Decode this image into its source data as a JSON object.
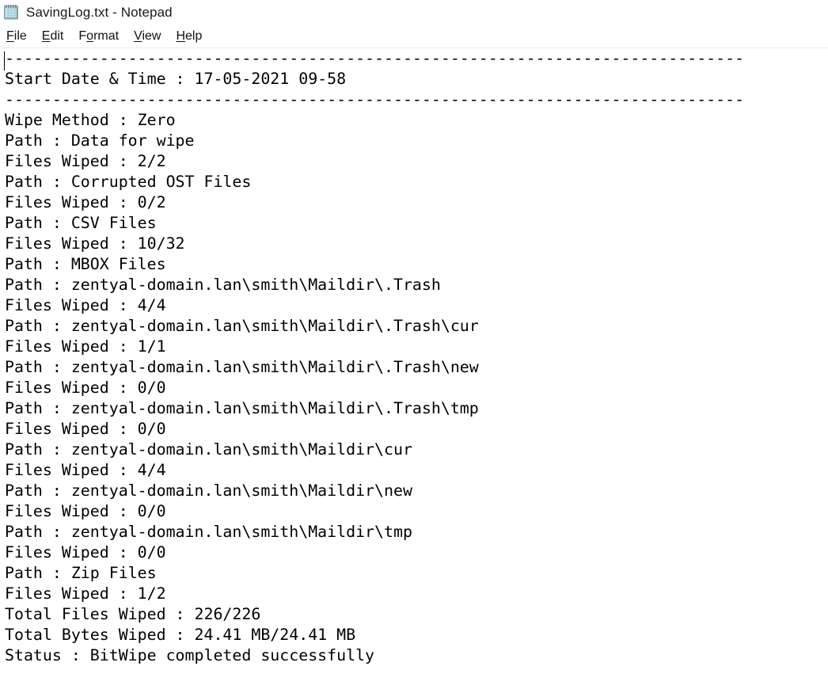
{
  "window": {
    "title": "SavingLog.txt - Notepad",
    "file_name": "SavingLog.txt",
    "app_name": "Notepad",
    "icon": "notepad-icon",
    "background_color": "#ffffff",
    "text_color": "#000000"
  },
  "menubar": {
    "items": [
      {
        "label": "File",
        "accel": "F",
        "before": "",
        "after": "ile"
      },
      {
        "label": "Edit",
        "accel": "E",
        "before": "",
        "after": "dit"
      },
      {
        "label": "Format",
        "accel": "o",
        "before": "F",
        "after": "rmat"
      },
      {
        "label": "View",
        "accel": "V",
        "before": "",
        "after": "iew"
      },
      {
        "label": "Help",
        "accel": "H",
        "before": "",
        "after": "elp"
      }
    ]
  },
  "document": {
    "caret_visible": true,
    "separator": "------------------------------------------------------------------------------",
    "header": {
      "start_label": "Start Date & Time",
      "start_value": "17-05-2021 09-58"
    },
    "summary": {
      "wipe_method_label": "Wipe Method",
      "wipe_method_value": "Zero",
      "total_files_label": "Total Files Wiped",
      "total_files_value": "226/226",
      "total_bytes_label": "Total Bytes Wiped",
      "total_bytes_value": "24.41 MB/24.41 MB",
      "status_label": "Status",
      "status_value": "BitWipe completed successfully"
    },
    "entries": [
      {
        "path": "Data for wipe",
        "files_wiped": "2/2"
      },
      {
        "path": "Corrupted OST Files",
        "files_wiped": "0/2"
      },
      {
        "path": "CSV Files",
        "files_wiped": "10/32"
      },
      {
        "path": "MBOX Files",
        "files_wiped": null
      },
      {
        "path": "zentyal-domain.lan\\smith\\Maildir\\.Trash",
        "files_wiped": "4/4"
      },
      {
        "path": "zentyal-domain.lan\\smith\\Maildir\\.Trash\\cur",
        "files_wiped": "1/1"
      },
      {
        "path": "zentyal-domain.lan\\smith\\Maildir\\.Trash\\new",
        "files_wiped": "0/0"
      },
      {
        "path": "zentyal-domain.lan\\smith\\Maildir\\.Trash\\tmp",
        "files_wiped": "0/0"
      },
      {
        "path": "zentyal-domain.lan\\smith\\Maildir\\cur",
        "files_wiped": "4/4"
      },
      {
        "path": "zentyal-domain.lan\\smith\\Maildir\\new",
        "files_wiped": "0/0"
      },
      {
        "path": "zentyal-domain.lan\\smith\\Maildir\\tmp",
        "files_wiped": "0/0"
      },
      {
        "path": "Zip Files",
        "files_wiped": "1/2"
      }
    ],
    "body_text": "------------------------------------------------------------------------------\nStart Date & Time : 17-05-2021 09-58\n------------------------------------------------------------------------------\nWipe Method : Zero\nPath : Data for wipe\nFiles Wiped : 2/2\nPath : Corrupted OST Files\nFiles Wiped : 0/2\nPath : CSV Files\nFiles Wiped : 10/32\nPath : MBOX Files\nPath : zentyal-domain.lan\\smith\\Maildir\\.Trash\nFiles Wiped : 4/4\nPath : zentyal-domain.lan\\smith\\Maildir\\.Trash\\cur\nFiles Wiped : 1/1\nPath : zentyal-domain.lan\\smith\\Maildir\\.Trash\\new\nFiles Wiped : 0/0\nPath : zentyal-domain.lan\\smith\\Maildir\\.Trash\\tmp\nFiles Wiped : 0/0\nPath : zentyal-domain.lan\\smith\\Maildir\\cur\nFiles Wiped : 4/4\nPath : zentyal-domain.lan\\smith\\Maildir\\new\nFiles Wiped : 0/0\nPath : zentyal-domain.lan\\smith\\Maildir\\tmp\nFiles Wiped : 0/0\nPath : Zip Files\nFiles Wiped : 1/2\nTotal Files Wiped : 226/226\nTotal Bytes Wiped : 24.41 MB/24.41 MB\nStatus : BitWipe completed successfully"
  }
}
